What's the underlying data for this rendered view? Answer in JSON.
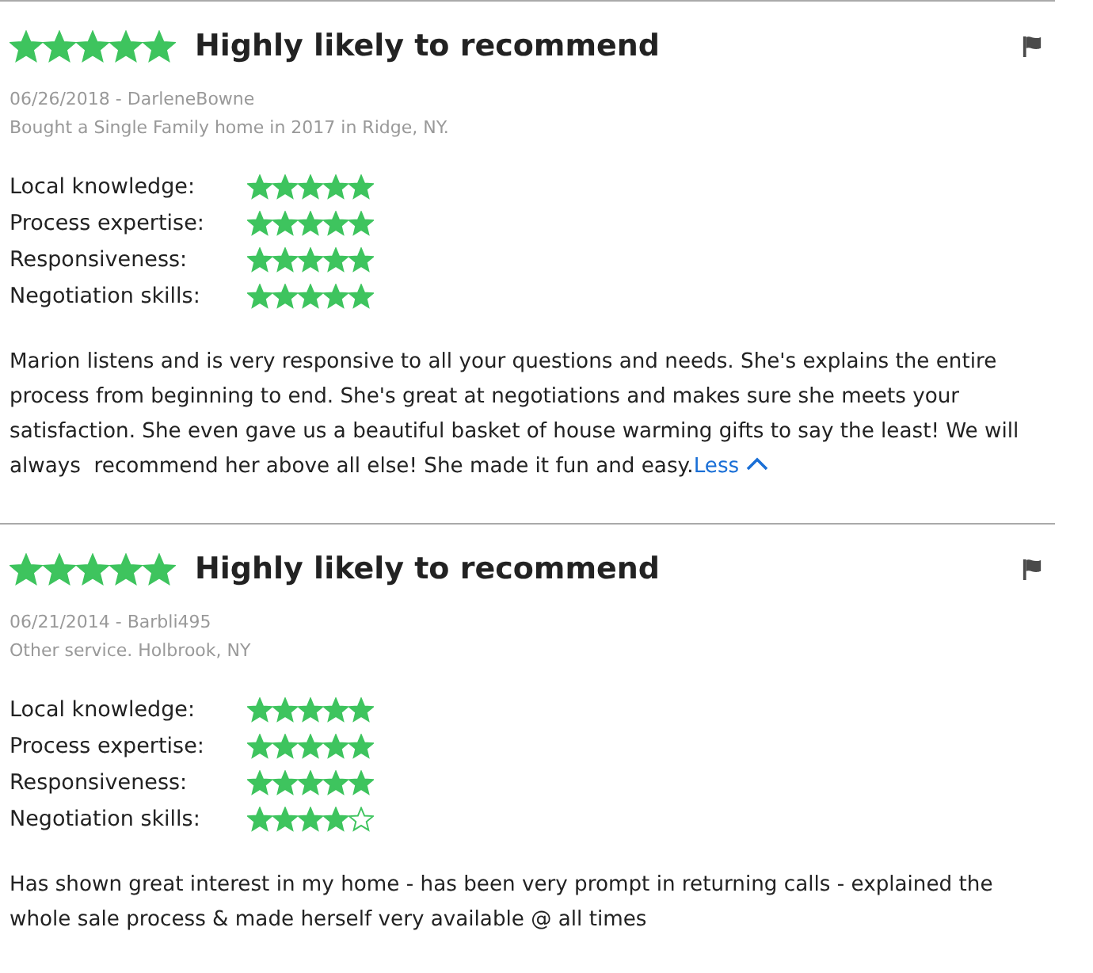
{
  "reviews": [
    {
      "stars": 5,
      "headline": "Highly likely to recommend",
      "byline": "06/26/2018 - DarleneBowne",
      "detail": "Bought a Single Family home in 2017 in Ridge, NY.",
      "ratings": [
        {
          "label": "Local knowledge:",
          "stars": 5
        },
        {
          "label": "Process expertise:",
          "stars": 5
        },
        {
          "label": "Responsiveness:",
          "stars": 5
        },
        {
          "label": "Negotiation skills:",
          "stars": 5
        }
      ],
      "text": "Marion listens and is very responsive to all your questions and needs. She's explains the entire process from beginning to end. She's great at negotiations and makes sure she meets your satisfaction. She even gave us a beautiful basket of house warming gifts to say the least! We will always  recommend her above all else! She made it fun and easy.",
      "toggle": "Less"
    },
    {
      "stars": 5,
      "headline": "Highly likely to recommend",
      "byline": "06/21/2014 - Barbli495",
      "detail": "Other service. Holbrook, NY",
      "ratings": [
        {
          "label": "Local knowledge:",
          "stars": 5
        },
        {
          "label": "Process expertise:",
          "stars": 5
        },
        {
          "label": "Responsiveness:",
          "stars": 5
        },
        {
          "label": "Negotiation skills:",
          "stars": 4
        }
      ],
      "text": "Has shown great interest in my home - has been very prompt in returning calls - explained the whole sale process & made herself very available @ all times"
    }
  ]
}
